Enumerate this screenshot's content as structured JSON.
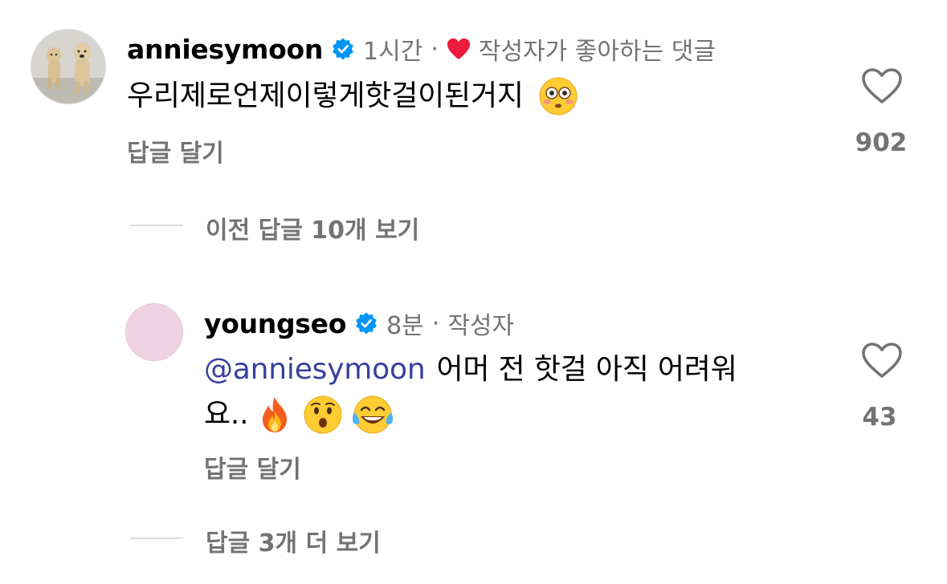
{
  "comment": {
    "username": "anniesymoon",
    "time": "1시간",
    "separator": "·",
    "liked_by_author_label": "작성자가 좋아하는 댓글",
    "text": "우리제로언제이렇게핫걸이된거지",
    "emoji": "flushed-face",
    "reply_label": "답글 달기",
    "like_count": "902"
  },
  "view_previous": {
    "label": "이전 답글 10개 보기"
  },
  "reply": {
    "username": "youngseo",
    "time": "8분",
    "separator": "·",
    "author_badge": "작성자",
    "mention": "@anniesymoon",
    "text_line1": "어머 전 핫걸 아직 어려워",
    "text_line2": "요..",
    "emojis": [
      "fire",
      "hushed-face",
      "face-with-tears-of-joy"
    ],
    "reply_label": "답글 달기",
    "like_count": "43"
  },
  "view_more": {
    "label": "답글 3개 더 보기"
  },
  "colors": {
    "verified": "#0095f6",
    "heart_red": "#ed1c3a",
    "meta_gray": "#737373",
    "mention_blue": "#37409c",
    "reply_avatar": "#f0d3e3"
  }
}
